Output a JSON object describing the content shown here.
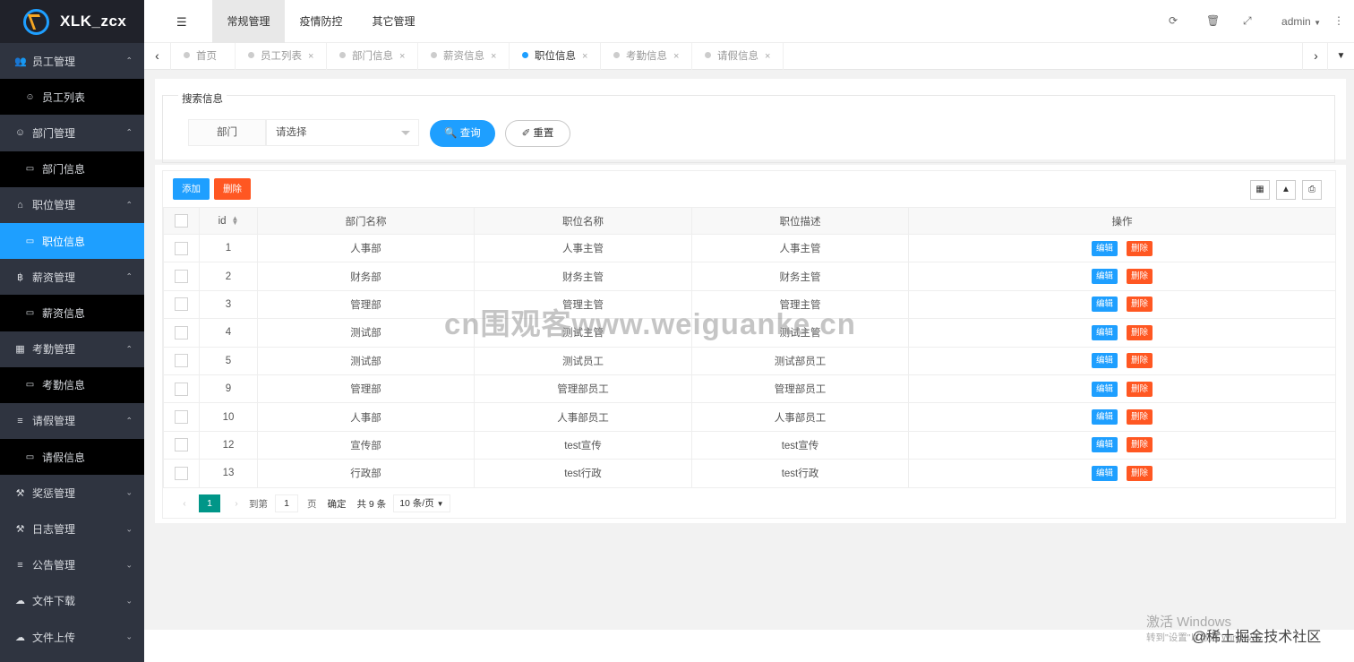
{
  "app": {
    "title": "XLK_zcx"
  },
  "sidebar": {
    "groups": [
      {
        "label": "员工管理",
        "icon": "users-icon",
        "expanded": true,
        "children": [
          {
            "label": "员工列表",
            "icon": "user-icon"
          }
        ]
      },
      {
        "label": "部门管理",
        "icon": "user-icon",
        "expanded": true,
        "children": [
          {
            "label": "部门信息",
            "icon": "card-icon"
          }
        ]
      },
      {
        "label": "职位管理",
        "icon": "bank-icon",
        "expanded": true,
        "children": [
          {
            "label": "职位信息",
            "icon": "card-icon",
            "active": true
          }
        ]
      },
      {
        "label": "薪资管理",
        "icon": "bitcoin-icon",
        "expanded": true,
        "children": [
          {
            "label": "薪资信息",
            "icon": "card-icon"
          }
        ]
      },
      {
        "label": "考勤管理",
        "icon": "calendar-icon",
        "expanded": true,
        "children": [
          {
            "label": "考勤信息",
            "icon": "card-icon"
          }
        ]
      },
      {
        "label": "请假管理",
        "icon": "bed-icon",
        "expanded": true,
        "children": [
          {
            "label": "请假信息",
            "icon": "card-icon"
          }
        ]
      },
      {
        "label": "奖惩管理",
        "icon": "gavel-icon",
        "expanded": false,
        "children": []
      },
      {
        "label": "日志管理",
        "icon": "gavel-icon",
        "expanded": false,
        "children": []
      },
      {
        "label": "公告管理",
        "icon": "list-icon",
        "expanded": false,
        "children": []
      },
      {
        "label": "文件下载",
        "icon": "cloud-download-icon",
        "expanded": false,
        "children": []
      },
      {
        "label": "文件上传",
        "icon": "cloud-upload-icon",
        "expanded": false,
        "children": []
      }
    ]
  },
  "header": {
    "tabs": [
      "常规管理",
      "疫情防控",
      "其它管理"
    ],
    "active_tab": "常规管理",
    "user": "admin"
  },
  "tabbar": {
    "tabs": [
      "首页",
      "员工列表",
      "部门信息",
      "薪资信息",
      "职位信息",
      "考勤信息",
      "请假信息"
    ],
    "active": "职位信息"
  },
  "search": {
    "legend": "搜索信息",
    "field_label": "部门",
    "select_placeholder": "请选择",
    "query_label": "查询",
    "reset_label": "重置"
  },
  "toolbar": {
    "add_label": "添加",
    "delete_label": "删除"
  },
  "table": {
    "columns": [
      "id",
      "部门名称",
      "职位名称",
      "职位描述",
      "操作"
    ],
    "edit_label": "编辑",
    "delete_label": "删除",
    "rows": [
      {
        "id": "1",
        "dept": "人事部",
        "position": "人事主管",
        "desc": "人事主管"
      },
      {
        "id": "2",
        "dept": "财务部",
        "position": "财务主管",
        "desc": "财务主管"
      },
      {
        "id": "3",
        "dept": "管理部",
        "position": "管理主管",
        "desc": "管理主管"
      },
      {
        "id": "4",
        "dept": "测试部",
        "position": "测试主管",
        "desc": "测试主管"
      },
      {
        "id": "5",
        "dept": "测试部",
        "position": "测试员工",
        "desc": "测试部员工"
      },
      {
        "id": "9",
        "dept": "管理部",
        "position": "管理部员工",
        "desc": "管理部员工"
      },
      {
        "id": "10",
        "dept": "人事部",
        "position": "人事部员工",
        "desc": "人事部员工"
      },
      {
        "id": "12",
        "dept": "宣传部",
        "position": "test宣传",
        "desc": "test宣传"
      },
      {
        "id": "13",
        "dept": "行政部",
        "position": "test行政",
        "desc": "test行政"
      }
    ]
  },
  "pager": {
    "current": "1",
    "goto_label": "到第",
    "goto_value": "1",
    "page_label": "页",
    "confirm_label": "确定",
    "total_label": "共 9 条",
    "per_page": "10 条/页"
  },
  "overlays": {
    "watermark": "cn围观客www.weiguanke.cn",
    "win_line1": "激活 Windows",
    "win_line2": "转到\"设置\"以激活 Windows。",
    "juejin": "@稀土掘金技术社区"
  },
  "colors": {
    "primary": "#1e9fff",
    "danger": "#ff5722",
    "pager": "#009688",
    "sidebar": "#2f3440"
  }
}
